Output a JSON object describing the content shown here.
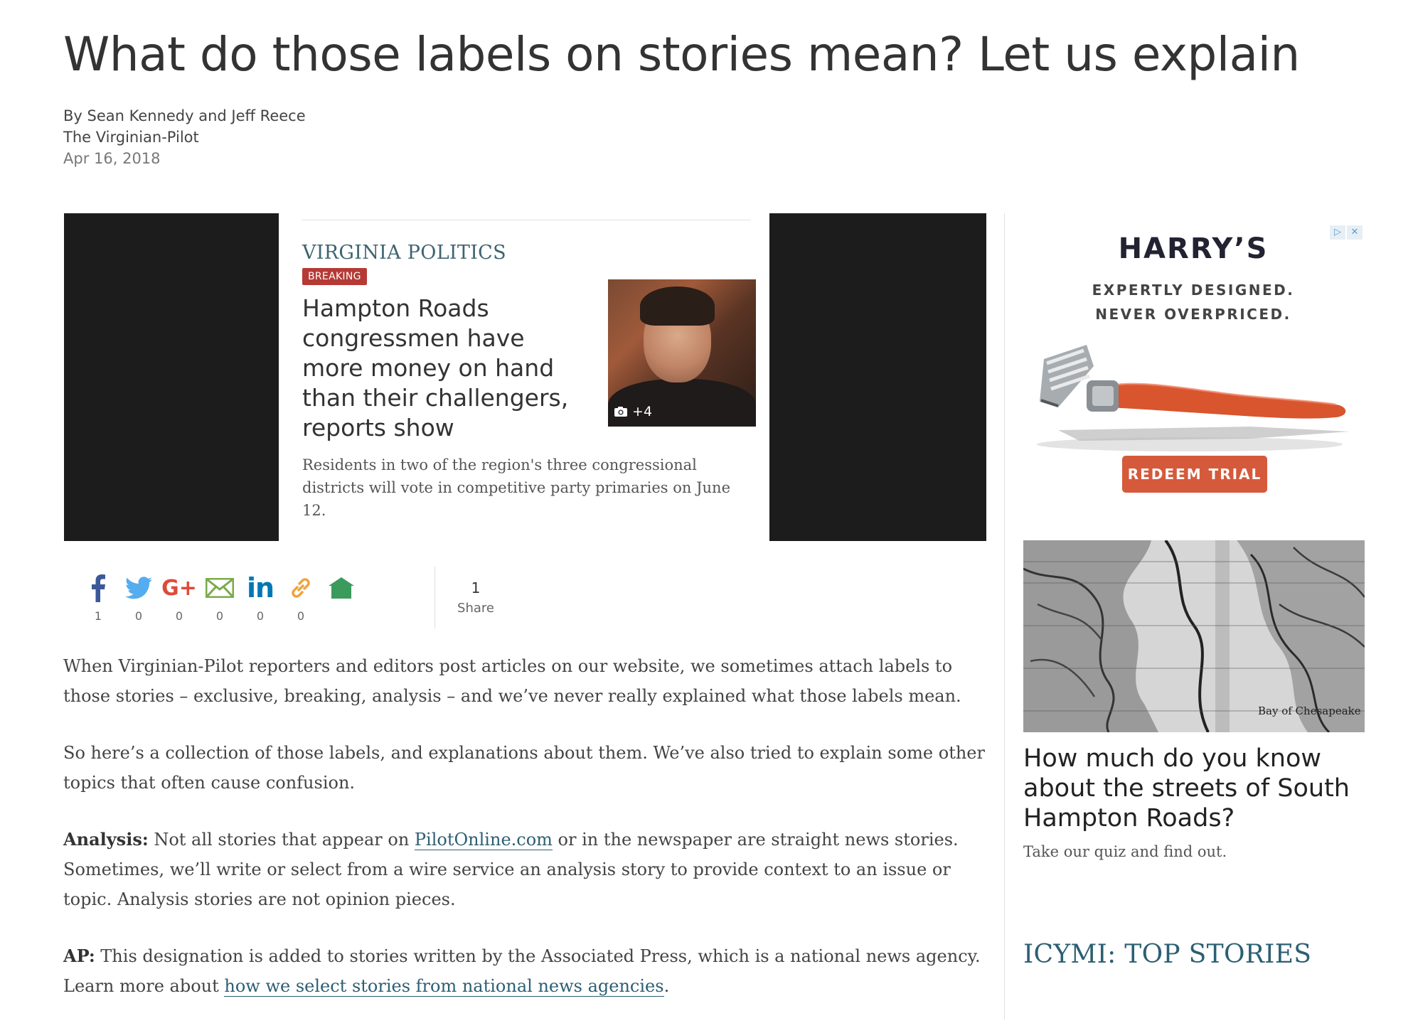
{
  "article": {
    "headline": "What do those labels on stories mean? Let us explain",
    "byline": "By Sean Kennedy and Jeff Reece",
    "publication": "The Virginian-Pilot",
    "date": "Apr 16, 2018"
  },
  "hero": {
    "section": "VIRGINIA POLITICS",
    "badge": "BREAKING",
    "story_title": "Hampton Roads congressmen have more money on hand than their challengers, reports show",
    "photo_count": "+4",
    "story_dek": "Residents in two of the region's three congressional districts will vote in competitive party primaries on June 12."
  },
  "share_bar": {
    "items": [
      {
        "icon": "facebook-icon",
        "count": "1",
        "color": "#3b5998"
      },
      {
        "icon": "twitter-icon",
        "count": "0",
        "color": "#55acee"
      },
      {
        "icon": "google-plus-icon",
        "count": "0",
        "color": "#dd4b39"
      },
      {
        "icon": "email-icon",
        "count": "0",
        "color": "#7aab4a"
      },
      {
        "icon": "linkedin-icon",
        "count": "0",
        "color": "#0077b5"
      },
      {
        "icon": "link-icon",
        "count": "0",
        "color": "#f0a33a"
      },
      {
        "icon": "home-icon",
        "count": "",
        "color": "#3a9b5d"
      }
    ],
    "total_count": "1",
    "total_label": "Share"
  },
  "body": {
    "p1": "When Virginian-Pilot reporters and editors post articles on our website, we sometimes attach labels to those stories – exclusive, breaking, analysis – and we’ve never really explained what those labels mean.",
    "p2": "So here’s a collection of those labels, and explanations about them. We’ve also tried to explain some other topics that often cause confusion.",
    "analysis_label": "Analysis:",
    "analysis_pre": " Not all stories that appear on ",
    "analysis_link": "PilotOnline.com",
    "analysis_post": " or in the newspaper are straight news stories. Sometimes, we’ll write or select from a wire service an analysis story to provide context to an issue or topic. Analysis stories are not opinion pieces.",
    "ap_label": "AP:",
    "ap_pre": " This designation is added to stories written by the Associated Press, which is a national news agency. Learn more about ",
    "ap_link": "how we select stories from national news agencies",
    "ap_post": "."
  },
  "ad": {
    "brand": "HARRY’S",
    "tagline_1": "EXPERTLY DESIGNED.",
    "tagline_2": "NEVER OVERPRICED.",
    "cta": "REDEEM TRIAL",
    "accent": "#d55a3b"
  },
  "sidebar": {
    "promo_title": "How much do you know about the streets of South Hampton Roads?",
    "promo_dek": "Take our quiz and find out.",
    "map_label": "Bay of Chesapeake",
    "icymi_heading": "ICYMI: TOP STORIES"
  }
}
